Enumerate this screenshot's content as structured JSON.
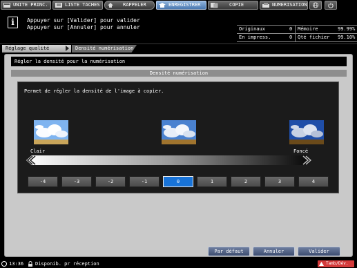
{
  "tabs": [
    {
      "label": "UNITE PRINC.",
      "icon": "main-unit-icon",
      "active": false
    },
    {
      "label": "LISTE TACHES",
      "icon": "job-list-icon",
      "active": false
    },
    {
      "label": "RAPPELER",
      "icon": "recall-icon",
      "active": false
    },
    {
      "label": "ENREGISTRER",
      "icon": "store-icon",
      "active": true
    },
    {
      "label": "COPIE",
      "icon": "copy-icon",
      "active": false
    },
    {
      "label": "NUMERISATION",
      "icon": "scan-icon",
      "active": false
    }
  ],
  "extra_tab_icons": [
    "globe-icon",
    "power-icon"
  ],
  "message": {
    "line1": "Appuyer sur [Valider] pour valider",
    "line2": "Appuyer sur [Annuler] pour annuler"
  },
  "counters": {
    "originals_label": "Originaux",
    "originals_value": "0",
    "memory_label": "Mémoire",
    "memory_value": "99.99%",
    "printing_label": "En impress.",
    "printing_value": "0",
    "file_label": "Qté fichier",
    "file_value": "99.10%"
  },
  "breadcrumb": {
    "item1": "Réglage qualité",
    "item2": "Densité numérisation"
  },
  "panel": {
    "header": "Régler la densité pour la numérisation",
    "section_title": "Densité numérisation",
    "description": "Permet de régler la densité de l'image à copier.",
    "label_light": "Clair",
    "label_dark": "Foncé"
  },
  "density_steps": [
    "-4",
    "-3",
    "-2",
    "-1",
    "0",
    "1",
    "2",
    "3",
    "4"
  ],
  "selected_step": "0",
  "buttons": {
    "default": "Par défaut",
    "cancel": "Annuler",
    "ok": "Valider"
  },
  "status": {
    "time": "13:36",
    "text": "Disponib. pr réception",
    "tamb": "Tamb/Dév."
  },
  "colors": {
    "selected_step": "#1873d8",
    "active_tab": "#4a78b0",
    "tamb_badge": "#d43a3a"
  }
}
